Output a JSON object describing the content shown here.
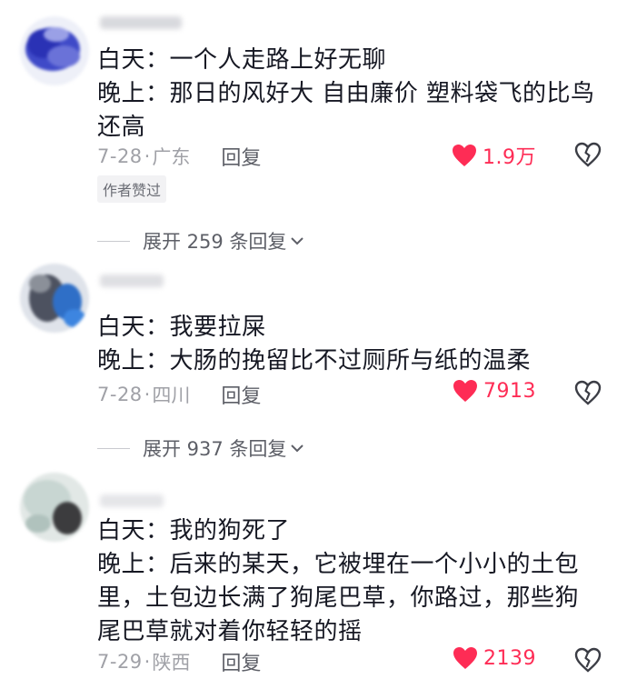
{
  "comments": [
    {
      "day_line": "白天：一个人走路上好无聊",
      "night_line_1": "晚上：那日的风好大 自由廉价 塑料袋飞的比鸟",
      "night_line_2": "还高",
      "date": "7-28",
      "location": "广东",
      "reply_label": "回复",
      "likes": "1.9万",
      "badge": "作者赞过",
      "expand_label": "展开 259 条回复"
    },
    {
      "day_line": "白天：我要拉屎",
      "night_line_1": "晚上：大肠的挽留比不过厕所与纸的温柔",
      "date": "7-28",
      "location": "四川",
      "reply_label": "回复",
      "likes": "7913",
      "expand_label": "展开 937 条回复"
    },
    {
      "day_line": "白天：我的狗死了",
      "night_line_1": "晚上：后来的某天，它被埋在一个小小的土包",
      "night_line_2": "里，土包边长满了狗尾巴草，你路过，那些狗",
      "night_line_3": "尾巴草就对着你轻轻的摇",
      "date": "7-29",
      "location": "陕西",
      "reply_label": "回复",
      "likes": "2139"
    }
  ],
  "separator": "·",
  "colors": {
    "like": "#fe2c55",
    "meta": "#a0a1a7",
    "text": "#161823"
  },
  "icons": {
    "like": "heart-icon",
    "dislike": "broken-heart-icon",
    "expand": "chevron-down-icon"
  }
}
